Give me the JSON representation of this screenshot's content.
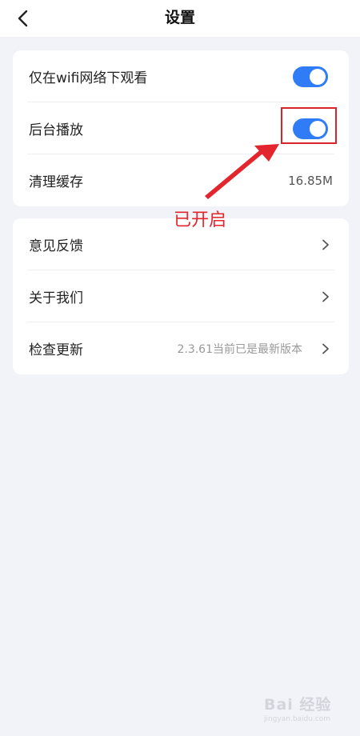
{
  "header": {
    "title": "设置",
    "back_icon": "chevron-left-icon"
  },
  "settings_group_1": {
    "items": [
      {
        "label": "仅在wifi网络下观看",
        "toggle_on": true
      },
      {
        "label": "后台播放",
        "toggle_on": true
      },
      {
        "label": "清理缓存",
        "value": "16.85M"
      }
    ]
  },
  "settings_group_2": {
    "items": [
      {
        "label": "意见反馈"
      },
      {
        "label": "关于我们"
      },
      {
        "label": "检查更新",
        "hint": "2.3.61当前已是最新版本"
      }
    ]
  },
  "annotation": {
    "text": "已开启",
    "color": "#e3262d"
  },
  "watermark": {
    "main": "Bai 经验",
    "sub": "jingyan.baidu.com"
  },
  "colors": {
    "toggle_on": "#2f7cf6",
    "background": "#f2f3f8"
  }
}
